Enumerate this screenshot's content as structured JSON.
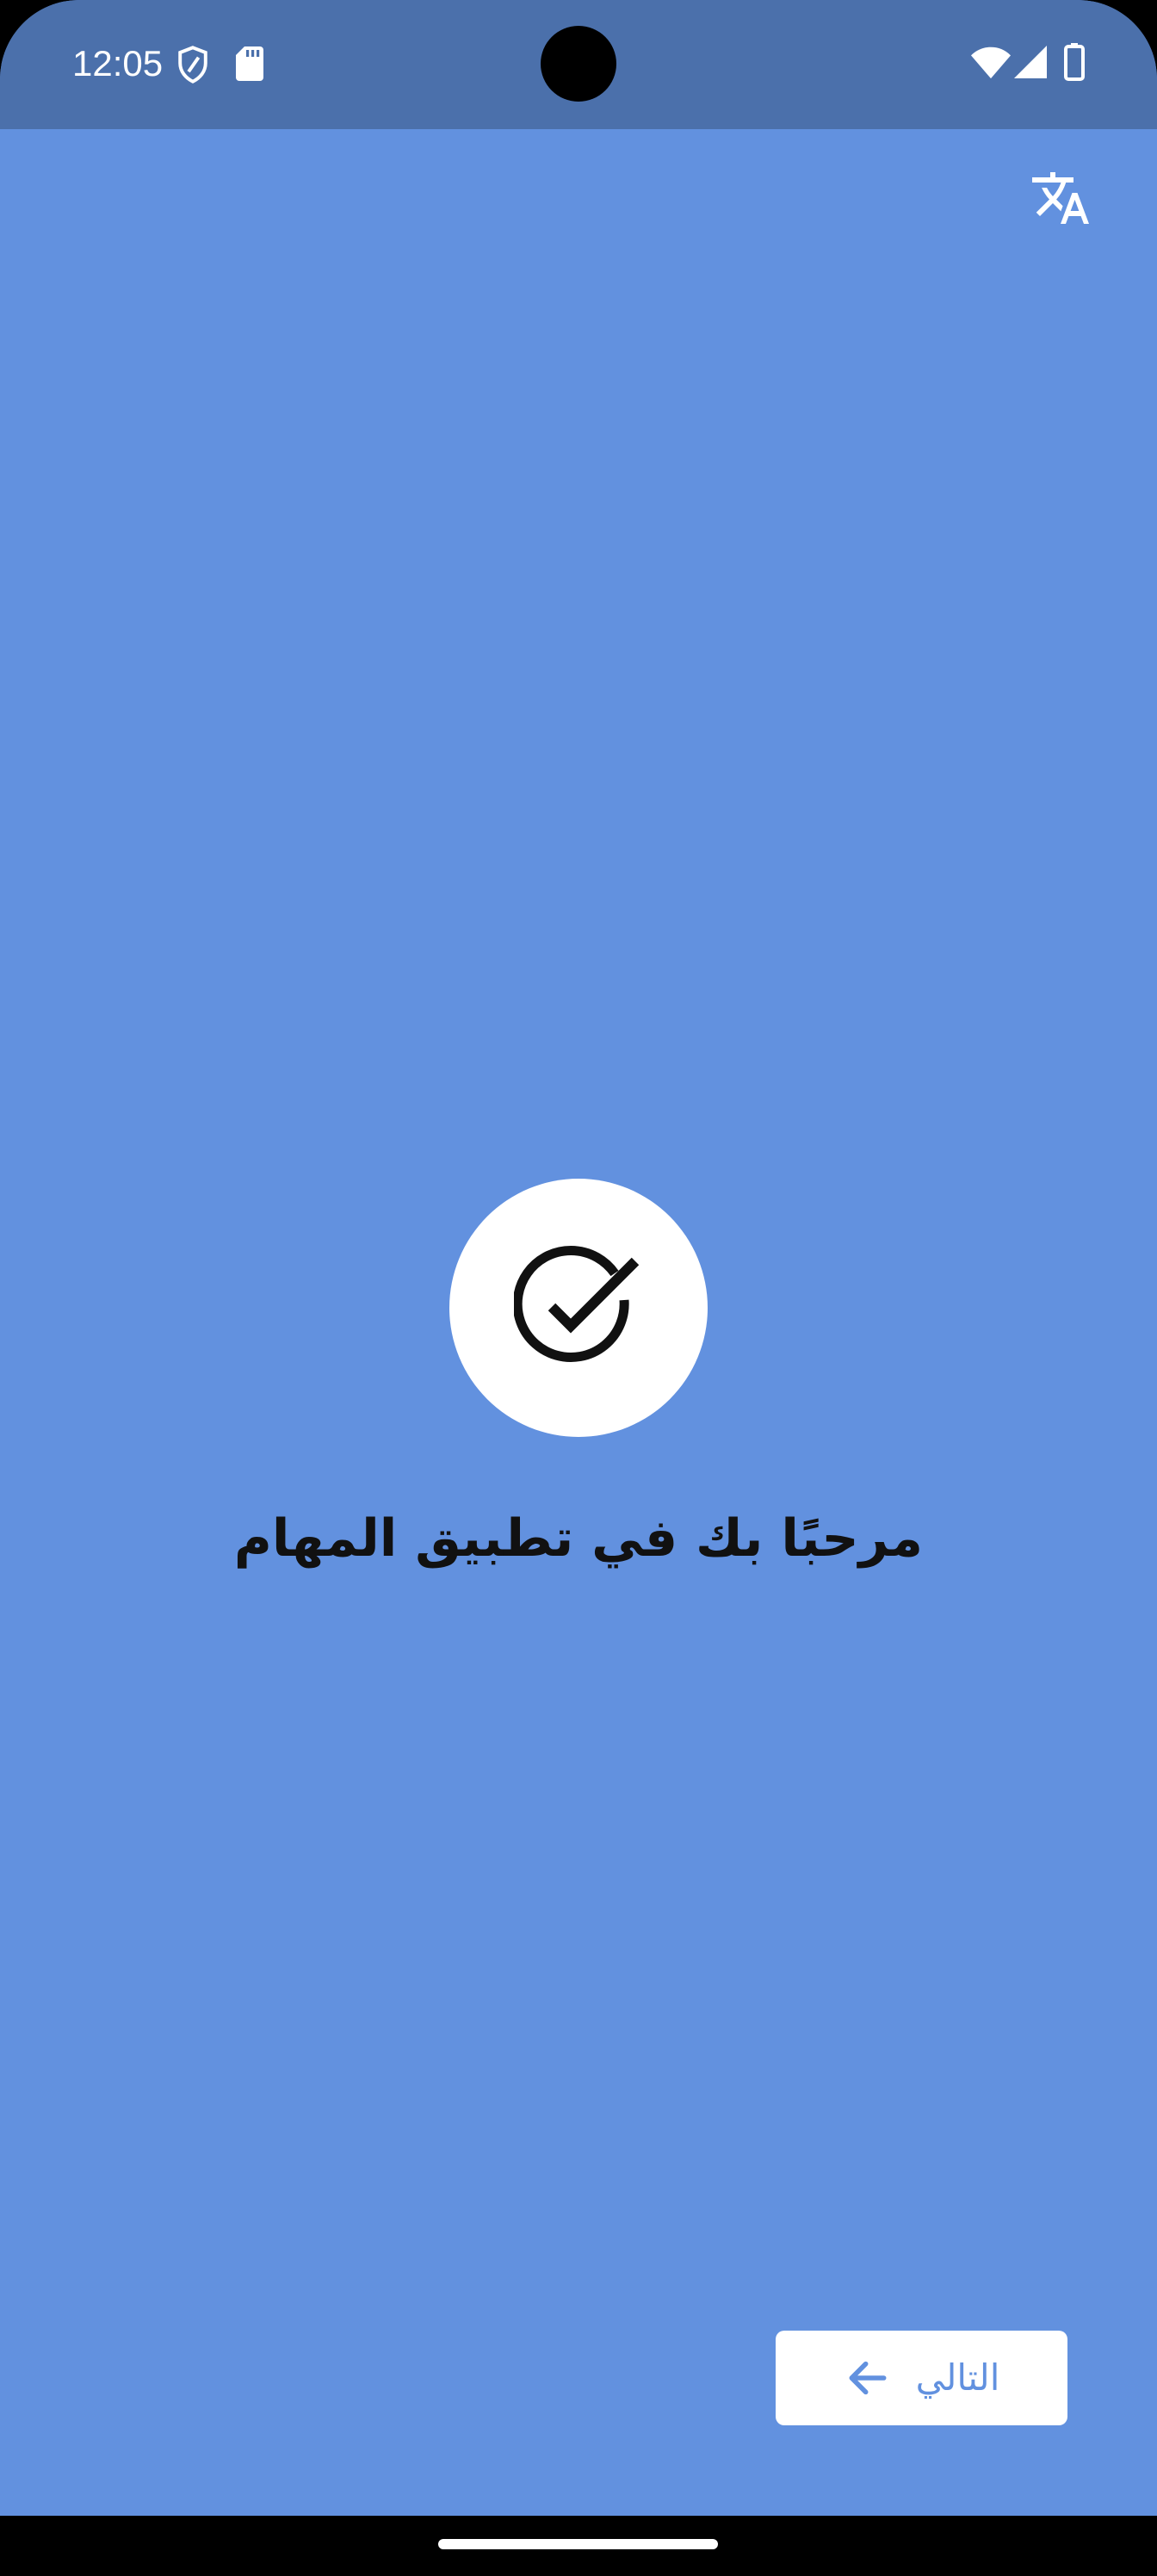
{
  "status_bar": {
    "time": "12:05",
    "icons": [
      "shield-icon",
      "sd-card-icon",
      "wifi-icon",
      "cell-signal-icon",
      "battery-icon"
    ]
  },
  "header": {
    "translate_icon": "translate-icon"
  },
  "onboarding": {
    "hero_icon": "check-circle-icon",
    "title": "مرحبًا بك في تطبيق المهام",
    "next_button_label": "التالي",
    "next_button_icon": "arrow-left-icon"
  },
  "colors": {
    "background": "#6291df",
    "status_bar": "#4b70ab",
    "button_background": "#ffffff",
    "button_text": "#6291df",
    "title_text": "#111111"
  }
}
